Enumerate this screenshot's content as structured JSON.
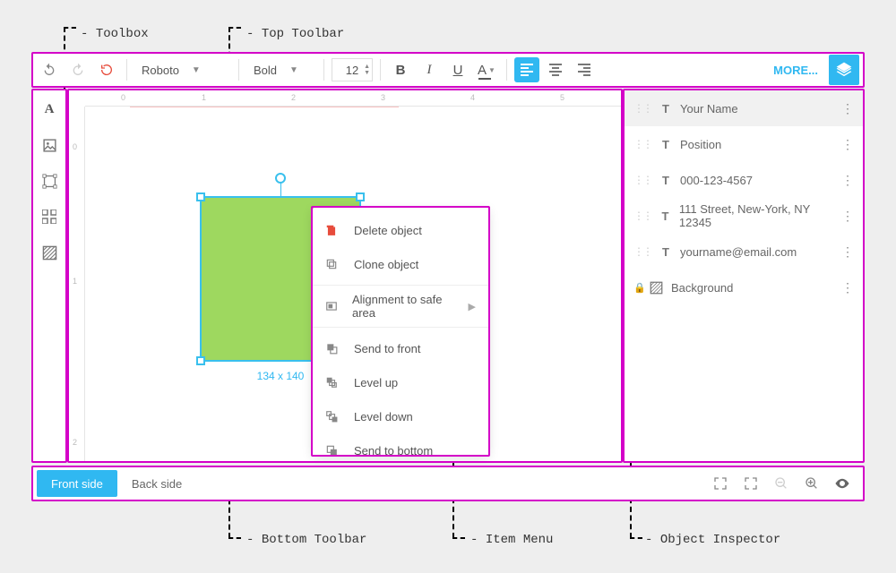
{
  "annotations": {
    "toolbox": "Toolbox",
    "top_toolbar": "Top Toolbar",
    "bottom_toolbar": "Bottom Toolbar",
    "item_menu": "Item Menu",
    "object_inspector": "Object Inspector"
  },
  "top_toolbar": {
    "font_family": "Roboto",
    "font_weight": "Bold",
    "font_size": "12",
    "more_label": "MORE..."
  },
  "canvas": {
    "selection_dimensions": "134 x 140",
    "ruler_h": [
      "0",
      "1",
      "2",
      "3",
      "4",
      "5"
    ],
    "ruler_v": [
      "0",
      "1",
      "2"
    ]
  },
  "item_menu": {
    "delete": "Delete object",
    "clone": "Clone object",
    "align": "Alignment to safe area",
    "front": "Send to front",
    "up": "Level up",
    "down": "Level down",
    "bottom": "Send to bottom"
  },
  "inspector": {
    "items": [
      {
        "type": "T",
        "label": "Your Name",
        "selected": true
      },
      {
        "type": "T",
        "label": "Position"
      },
      {
        "type": "T",
        "label": "000-123-4567"
      },
      {
        "type": "T",
        "label": "111 Street, New-York, NY 12345"
      },
      {
        "type": "T",
        "label": "yourname@email.com"
      },
      {
        "type": "img",
        "label": "Background",
        "locked": true
      }
    ]
  },
  "bottom": {
    "front_tab": "Front side",
    "back_tab": "Back side"
  }
}
